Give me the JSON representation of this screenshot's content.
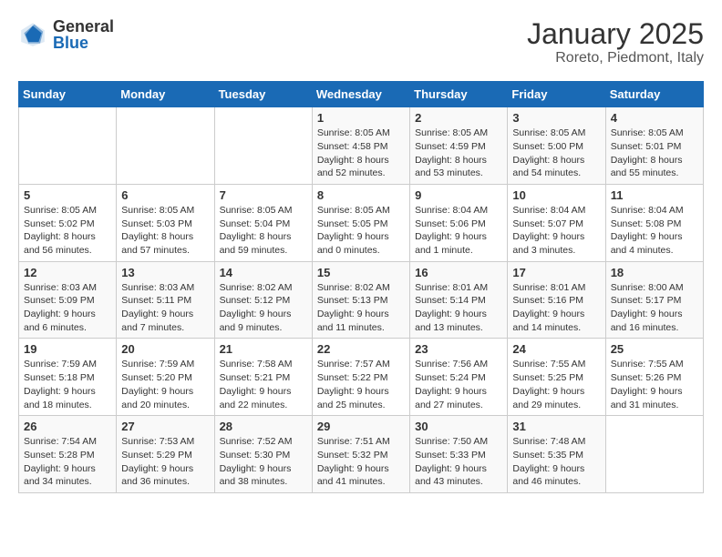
{
  "header": {
    "logo": {
      "general_text": "General",
      "blue_text": "Blue"
    },
    "title": "January 2025",
    "location": "Roreto, Piedmont, Italy"
  },
  "weekdays": [
    "Sunday",
    "Monday",
    "Tuesday",
    "Wednesday",
    "Thursday",
    "Friday",
    "Saturday"
  ],
  "weeks": [
    [
      {
        "day": "",
        "info": ""
      },
      {
        "day": "",
        "info": ""
      },
      {
        "day": "",
        "info": ""
      },
      {
        "day": "1",
        "info": "Sunrise: 8:05 AM\nSunset: 4:58 PM\nDaylight: 8 hours\nand 52 minutes."
      },
      {
        "day": "2",
        "info": "Sunrise: 8:05 AM\nSunset: 4:59 PM\nDaylight: 8 hours\nand 53 minutes."
      },
      {
        "day": "3",
        "info": "Sunrise: 8:05 AM\nSunset: 5:00 PM\nDaylight: 8 hours\nand 54 minutes."
      },
      {
        "day": "4",
        "info": "Sunrise: 8:05 AM\nSunset: 5:01 PM\nDaylight: 8 hours\nand 55 minutes."
      }
    ],
    [
      {
        "day": "5",
        "info": "Sunrise: 8:05 AM\nSunset: 5:02 PM\nDaylight: 8 hours\nand 56 minutes."
      },
      {
        "day": "6",
        "info": "Sunrise: 8:05 AM\nSunset: 5:03 PM\nDaylight: 8 hours\nand 57 minutes."
      },
      {
        "day": "7",
        "info": "Sunrise: 8:05 AM\nSunset: 5:04 PM\nDaylight: 8 hours\nand 59 minutes."
      },
      {
        "day": "8",
        "info": "Sunrise: 8:05 AM\nSunset: 5:05 PM\nDaylight: 9 hours\nand 0 minutes."
      },
      {
        "day": "9",
        "info": "Sunrise: 8:04 AM\nSunset: 5:06 PM\nDaylight: 9 hours\nand 1 minute."
      },
      {
        "day": "10",
        "info": "Sunrise: 8:04 AM\nSunset: 5:07 PM\nDaylight: 9 hours\nand 3 minutes."
      },
      {
        "day": "11",
        "info": "Sunrise: 8:04 AM\nSunset: 5:08 PM\nDaylight: 9 hours\nand 4 minutes."
      }
    ],
    [
      {
        "day": "12",
        "info": "Sunrise: 8:03 AM\nSunset: 5:09 PM\nDaylight: 9 hours\nand 6 minutes."
      },
      {
        "day": "13",
        "info": "Sunrise: 8:03 AM\nSunset: 5:11 PM\nDaylight: 9 hours\nand 7 minutes."
      },
      {
        "day": "14",
        "info": "Sunrise: 8:02 AM\nSunset: 5:12 PM\nDaylight: 9 hours\nand 9 minutes."
      },
      {
        "day": "15",
        "info": "Sunrise: 8:02 AM\nSunset: 5:13 PM\nDaylight: 9 hours\nand 11 minutes."
      },
      {
        "day": "16",
        "info": "Sunrise: 8:01 AM\nSunset: 5:14 PM\nDaylight: 9 hours\nand 13 minutes."
      },
      {
        "day": "17",
        "info": "Sunrise: 8:01 AM\nSunset: 5:16 PM\nDaylight: 9 hours\nand 14 minutes."
      },
      {
        "day": "18",
        "info": "Sunrise: 8:00 AM\nSunset: 5:17 PM\nDaylight: 9 hours\nand 16 minutes."
      }
    ],
    [
      {
        "day": "19",
        "info": "Sunrise: 7:59 AM\nSunset: 5:18 PM\nDaylight: 9 hours\nand 18 minutes."
      },
      {
        "day": "20",
        "info": "Sunrise: 7:59 AM\nSunset: 5:20 PM\nDaylight: 9 hours\nand 20 minutes."
      },
      {
        "day": "21",
        "info": "Sunrise: 7:58 AM\nSunset: 5:21 PM\nDaylight: 9 hours\nand 22 minutes."
      },
      {
        "day": "22",
        "info": "Sunrise: 7:57 AM\nSunset: 5:22 PM\nDaylight: 9 hours\nand 25 minutes."
      },
      {
        "day": "23",
        "info": "Sunrise: 7:56 AM\nSunset: 5:24 PM\nDaylight: 9 hours\nand 27 minutes."
      },
      {
        "day": "24",
        "info": "Sunrise: 7:55 AM\nSunset: 5:25 PM\nDaylight: 9 hours\nand 29 minutes."
      },
      {
        "day": "25",
        "info": "Sunrise: 7:55 AM\nSunset: 5:26 PM\nDaylight: 9 hours\nand 31 minutes."
      }
    ],
    [
      {
        "day": "26",
        "info": "Sunrise: 7:54 AM\nSunset: 5:28 PM\nDaylight: 9 hours\nand 34 minutes."
      },
      {
        "day": "27",
        "info": "Sunrise: 7:53 AM\nSunset: 5:29 PM\nDaylight: 9 hours\nand 36 minutes."
      },
      {
        "day": "28",
        "info": "Sunrise: 7:52 AM\nSunset: 5:30 PM\nDaylight: 9 hours\nand 38 minutes."
      },
      {
        "day": "29",
        "info": "Sunrise: 7:51 AM\nSunset: 5:32 PM\nDaylight: 9 hours\nand 41 minutes."
      },
      {
        "day": "30",
        "info": "Sunrise: 7:50 AM\nSunset: 5:33 PM\nDaylight: 9 hours\nand 43 minutes."
      },
      {
        "day": "31",
        "info": "Sunrise: 7:48 AM\nSunset: 5:35 PM\nDaylight: 9 hours\nand 46 minutes."
      },
      {
        "day": "",
        "info": ""
      }
    ]
  ]
}
